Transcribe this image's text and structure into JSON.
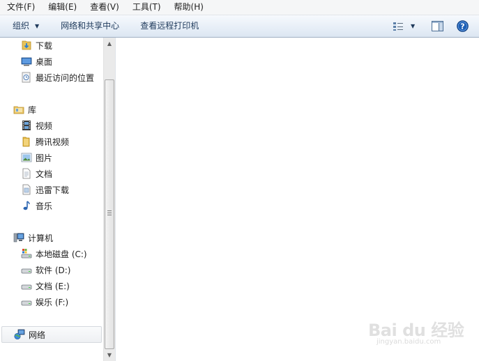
{
  "menu": [
    "文件(F)",
    "编辑(E)",
    "查看(V)",
    "工具(T)",
    "帮助(H)"
  ],
  "toolbar": {
    "organize": "组织",
    "network_center": "网络和共享中心",
    "view_printers": "查看远程打印机"
  },
  "nav": {
    "favorites": [
      "下载",
      "桌面",
      "最近访问的位置"
    ],
    "library": "库",
    "library_items": [
      "视频",
      "腾讯视频",
      "图片",
      "文档",
      "迅雷下载",
      "音乐"
    ],
    "computer": "计算机",
    "drives": [
      "本地磁盘 (C:)",
      "软件 (D:)",
      "文档 (E:)",
      "娱乐 (F:)"
    ],
    "network": "网络"
  },
  "watermark": {
    "logo": "Bai du 经验",
    "url": "jingyan.baidu.com"
  },
  "colors": {
    "menubar_bg": "#f5f6f7",
    "cmdbar_text": "#1e395b",
    "help_blue": "#1d5fb5"
  }
}
